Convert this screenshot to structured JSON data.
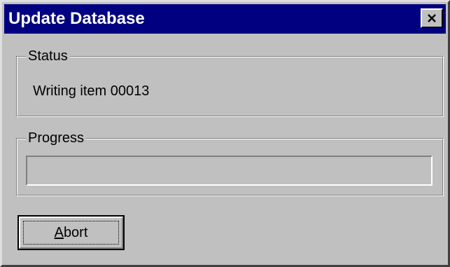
{
  "window": {
    "title": "Update Database",
    "close_icon": "close-icon",
    "titlebar_color": "#000080",
    "face_color": "#c0c0c0"
  },
  "status": {
    "label": "Status",
    "text": "Writing item 00013"
  },
  "progress": {
    "label": "Progress",
    "fraction": 0
  },
  "abort_button": {
    "accel": "A",
    "rest": "bort"
  }
}
